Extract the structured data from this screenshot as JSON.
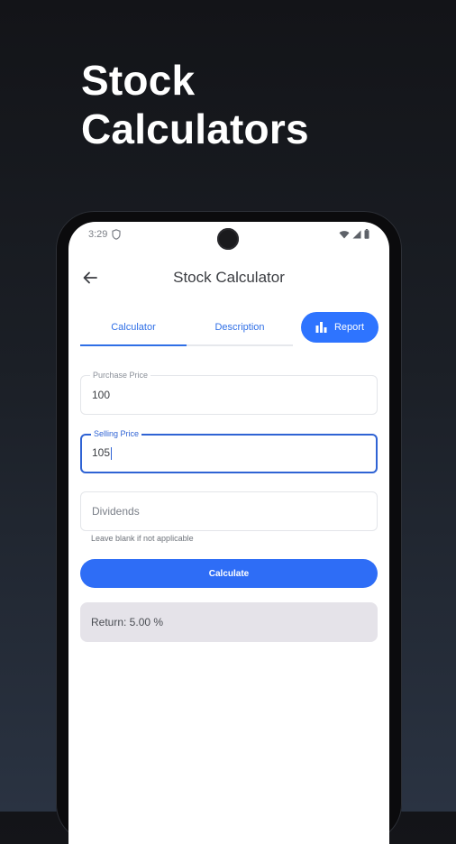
{
  "promo": {
    "headline_line1": "Stock",
    "headline_line2": "Calculators"
  },
  "status_bar": {
    "time": "3:29"
  },
  "app_bar": {
    "title": "Stock Calculator"
  },
  "tabs": [
    {
      "label": "Calculator",
      "selected": true
    },
    {
      "label": "Description",
      "selected": false
    }
  ],
  "report_button": {
    "label": "Report"
  },
  "fields": {
    "purchase_price": {
      "label": "Purchase Price",
      "value": "100"
    },
    "selling_price": {
      "label": "Selling Price",
      "value": "105"
    },
    "dividends": {
      "placeholder": "Dividends",
      "value": "",
      "helper": "Leave blank if not applicable"
    }
  },
  "calculate_button": {
    "label": "Calculate"
  },
  "result": {
    "text": "Return: 5.00 %"
  },
  "colors": {
    "accent": "#2e6df6",
    "focus_border": "#2f63d4",
    "result_bg": "#e5e3e9"
  },
  "icons": {
    "back": "arrow-left-icon",
    "report": "bar-chart-icon",
    "wifi": "wifi-icon",
    "signal": "signal-icon",
    "battery": "battery-icon",
    "shield": "shield-icon"
  }
}
